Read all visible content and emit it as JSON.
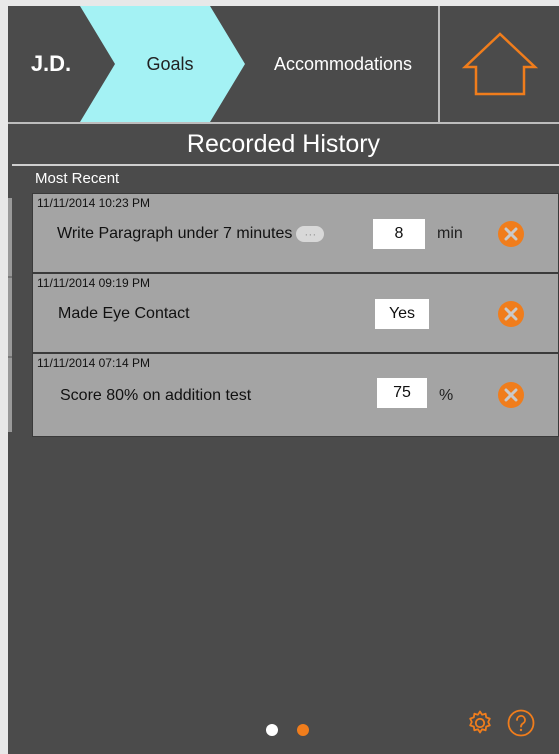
{
  "header": {
    "user_initials": "J.D.",
    "tabs": [
      {
        "label": "Goals",
        "active": true
      },
      {
        "label": "Accommodations",
        "active": false
      }
    ],
    "home_icon": "home-icon",
    "active_tab_color": "#a4f2f4",
    "accent_color": "#f07d1c"
  },
  "page": {
    "title": "Recorded History",
    "section_label": "Most Recent"
  },
  "records": [
    {
      "timestamp": "11/11/2014 10:23 PM",
      "goal": "Write Paragraph under 7 minutes",
      "has_note": true,
      "value": "8",
      "unit": "min"
    },
    {
      "timestamp": "11/11/2014 09:19 PM",
      "goal": "Made Eye Contact",
      "has_note": false,
      "value": "Yes",
      "unit": ""
    },
    {
      "timestamp": "11/11/2014 07:14 PM",
      "goal": "Score 80% on addition test",
      "has_note": false,
      "value": "75",
      "unit": "%"
    }
  ],
  "pagination": {
    "pages": 2,
    "current": 2
  },
  "footer": {
    "settings_icon": "gear-icon",
    "help_icon": "help-icon"
  }
}
